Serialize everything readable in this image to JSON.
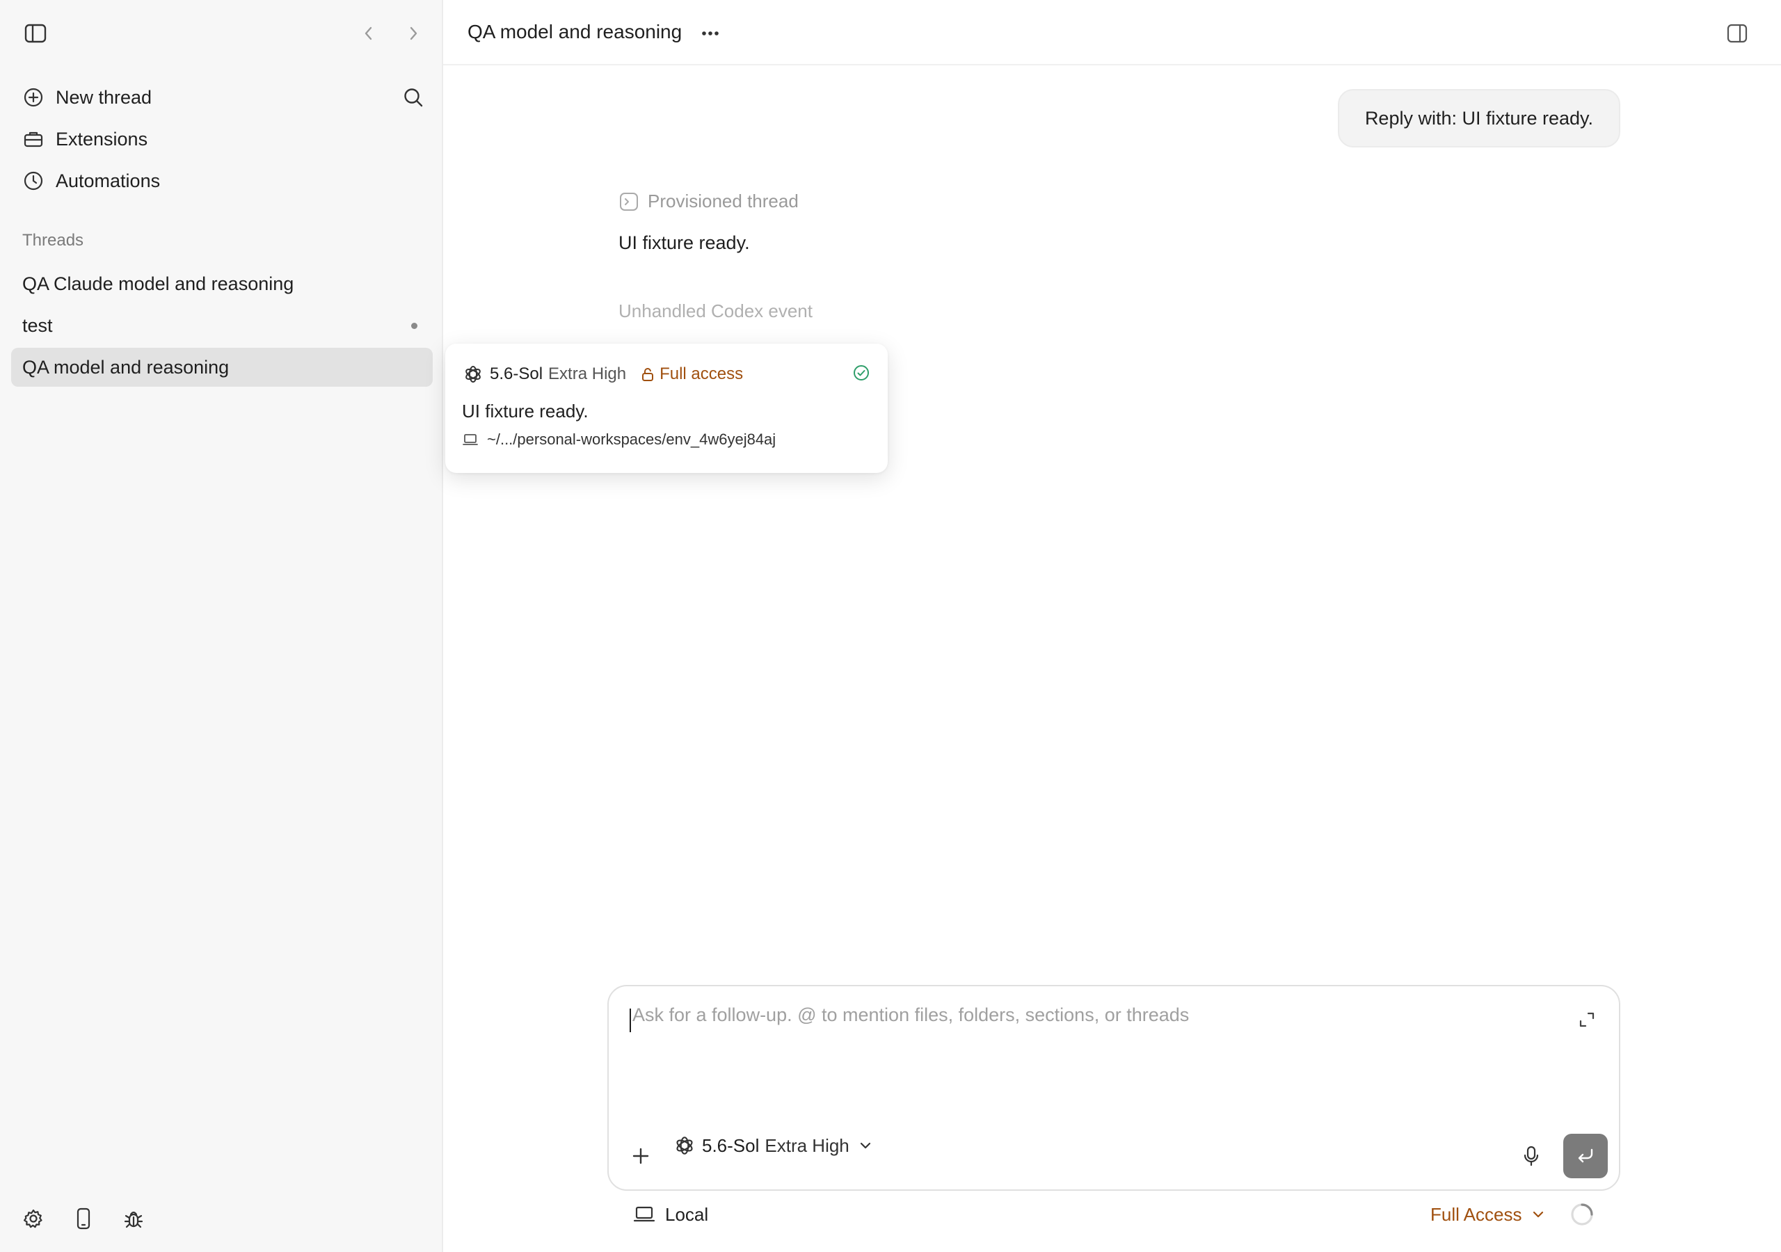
{
  "sidebar": {
    "nav": [
      {
        "label": "New thread",
        "icon": "plus-circle-icon"
      },
      {
        "label": "Extensions",
        "icon": "toolbox-icon"
      },
      {
        "label": "Automations",
        "icon": "clock-icon"
      }
    ],
    "threads_label": "Threads",
    "threads": [
      {
        "label": "QA Claude model and reasoning"
      },
      {
        "label": "test"
      },
      {
        "label": "QA model and reasoning"
      }
    ]
  },
  "header": {
    "title": "QA model and reasoning",
    "more": "···"
  },
  "conversation": {
    "user_message": "Reply with: UI fixture ready.",
    "provisioned_label": "Provisioned thread",
    "assistant_reply": "UI fixture ready.",
    "unhandled_label": "Unhandled Codex event"
  },
  "popover": {
    "model": "5.6-Sol",
    "effort": "Extra High",
    "access": "Full access",
    "message": "UI fixture ready.",
    "path": "~/.../personal-workspaces/env_4w6yej84aj"
  },
  "composer": {
    "placeholder": "Ask for a follow-up. @ to mention files, folders, sections, or threads",
    "model": "5.6-Sol",
    "effort": "Extra High"
  },
  "footer": {
    "location": "Local",
    "access": "Full Access"
  },
  "colors": {
    "accent_access": "#a0500f",
    "success": "#2f9e6a",
    "active_row": "#e2e2e2"
  }
}
